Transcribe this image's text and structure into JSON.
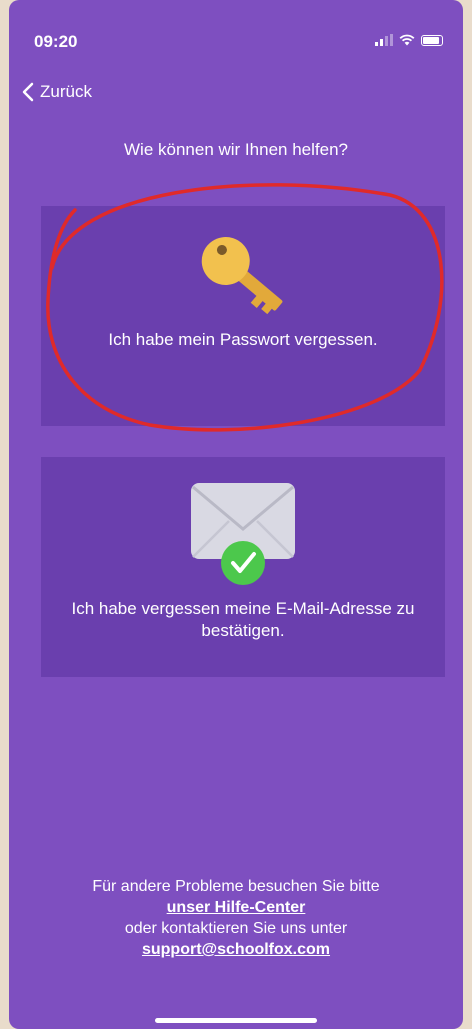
{
  "status_bar": {
    "time": "09:20"
  },
  "nav": {
    "back_label": "Zurück"
  },
  "page": {
    "title": "Wie können wir Ihnen helfen?"
  },
  "options": [
    {
      "label": "Ich habe mein Passwort vergessen.",
      "icon": "key-icon"
    },
    {
      "label": "Ich habe vergessen meine E-Mail-Adresse zu bestätigen.",
      "icon": "envelope-check-icon"
    }
  ],
  "footer": {
    "line1": "Für andere Probleme besuchen Sie bitte",
    "help_center_link": "unser Hilfe-Center",
    "line3": "oder kontaktieren Sie uns unter",
    "support_email": "support@schoolfox.com"
  },
  "colors": {
    "background": "#7e4fc0",
    "card": "#6a3fae",
    "annotation": "#e02a2a",
    "key": "#f2c14e",
    "check": "#4cc84c"
  }
}
